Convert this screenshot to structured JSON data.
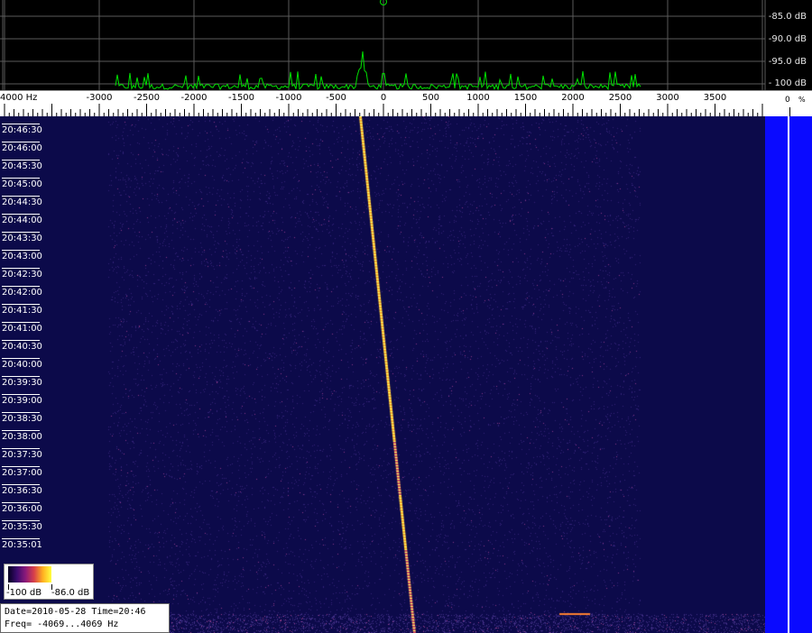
{
  "spectrum": {
    "db_labels": [
      "-85.0 dB",
      "-90.0 dB",
      "-95.0 dB",
      "- 100 dB"
    ],
    "trace_color": "#00e000",
    "grid_color": "#5a5a5a"
  },
  "freq_scale": {
    "unit_label": "4000 Hz",
    "ticks": [
      "-3000",
      "-2500",
      "-2000",
      "-1500",
      "-1000",
      "-500",
      "0",
      "500",
      "1000",
      "1500",
      "2000",
      "2500",
      "3000",
      "3500"
    ],
    "tick_values": [
      -3000,
      -2500,
      -2000,
      -1500,
      -1000,
      -500,
      0,
      500,
      1000,
      1500,
      2000,
      2500,
      3000,
      3500
    ],
    "range_hz": [
      -4069,
      4069
    ]
  },
  "level_meter": {
    "percent_label": "0",
    "percent_unit": "%",
    "bar_color": "#0a0aff"
  },
  "waterfall": {
    "background_color": "#0c0a4a",
    "time_labels": [
      "20:46:30",
      "20:46:00",
      "20:45:30",
      "20:45:00",
      "20:44:30",
      "20:44:00",
      "20:43:30",
      "20:43:00",
      "20:42:30",
      "20:42:00",
      "20:41:30",
      "20:41:00",
      "20:40:30",
      "20:40:00",
      "20:39:30",
      "20:39:00",
      "20:38:30",
      "20:38:00",
      "20:37:30",
      "20:37:00",
      "20:36:30",
      "20:36:00",
      "20:35:30",
      "20:35:01"
    ]
  },
  "legend": {
    "min_label": "-100 dB",
    "max_label": "-86.0 dB"
  },
  "info": {
    "date_line": "Date=2010-05-28 Time=20:46",
    "freq_line": "Freq= -4069...4069 Hz"
  }
}
